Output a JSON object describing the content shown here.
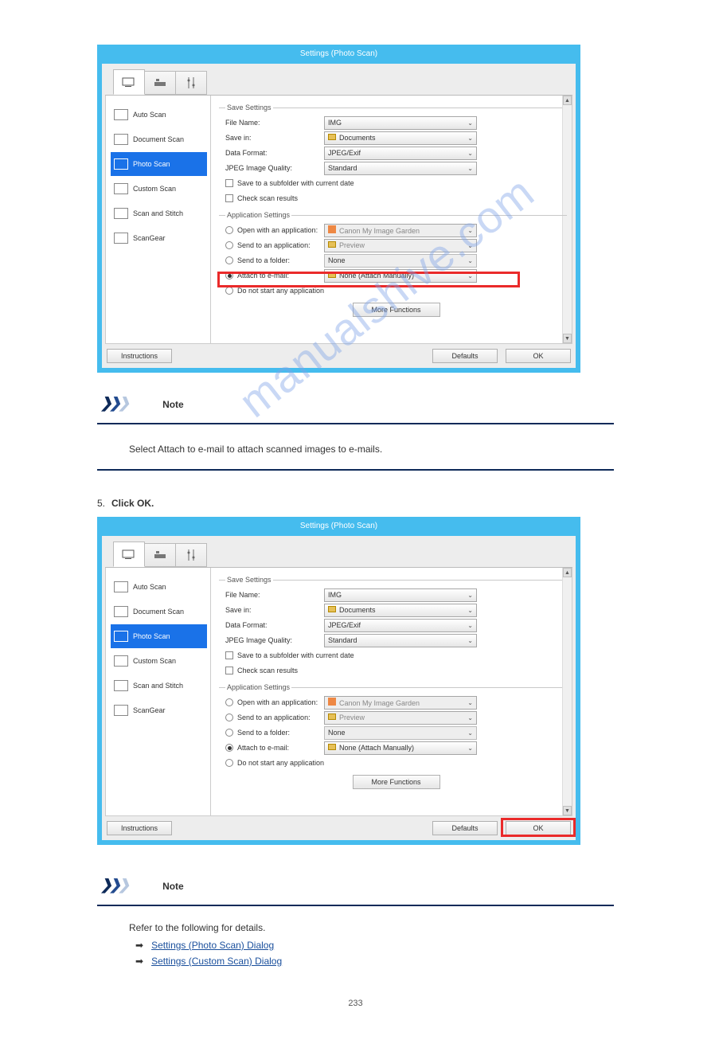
{
  "dialog": {
    "title": "Settings (Photo Scan)",
    "sidebar": [
      "Auto Scan",
      "Document Scan",
      "Photo Scan",
      "Custom Scan",
      "Scan and Stitch",
      "ScanGear"
    ],
    "save_section": {
      "legend": "Save Settings",
      "file_name": {
        "label": "File Name:",
        "value": "IMG"
      },
      "save_in": {
        "label": "Save in:",
        "value": "Documents"
      },
      "format": {
        "label": "Data Format:",
        "value": "JPEG/Exif"
      },
      "quality": {
        "label": "JPEG Image Quality:",
        "value": "Standard"
      },
      "subfolder": "Save to a subfolder with current date",
      "checkres": "Check scan results"
    },
    "app_section": {
      "legend": "Application Settings",
      "open_app": {
        "label": "Open with an application:",
        "value": "Canon My Image Garden"
      },
      "send_app": {
        "label": "Send to an application:",
        "value": "Preview"
      },
      "send_fold": {
        "label": "Send to a folder:",
        "value": "None"
      },
      "attach": {
        "label": "Attach to e-mail:",
        "value": "None (Attach Manually)"
      },
      "no_start": "Do not start any application",
      "more": "More Functions"
    },
    "buttons": {
      "instructions": "Instructions",
      "defaults": "Defaults",
      "ok": "OK"
    }
  },
  "notes": {
    "note_label": "Note",
    "note_text": "Select Attach to e-mail to attach scanned images to e-mails.",
    "step5": "Click OK.",
    "note2_label": "Note",
    "note2_lead": "Refer to the following for details.",
    "link1": "Settings (Photo Scan) Dialog",
    "link2": "Settings (Custom Scan) Dialog"
  },
  "watermark": "manualshive.com",
  "page_number": "233"
}
